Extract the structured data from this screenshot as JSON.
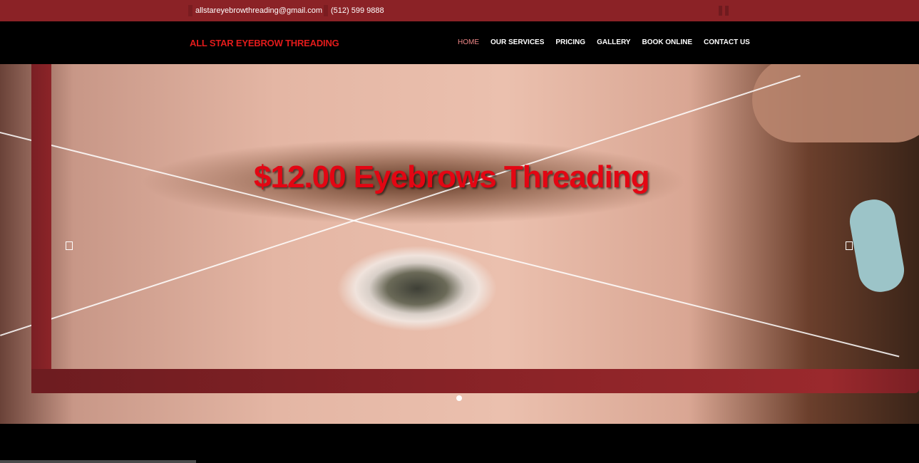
{
  "topbar": {
    "email": "allstareyebrowthreading@gmail.com",
    "phone": "(512) 599 9888"
  },
  "header": {
    "logo": "ALL STAR EYEBROW THREADING",
    "nav": [
      {
        "label": "HOME",
        "active": true
      },
      {
        "label": "OUR SERVICES",
        "active": false
      },
      {
        "label": "PRICING",
        "active": false
      },
      {
        "label": "GALLERY",
        "active": false
      },
      {
        "label": "BOOK ONLINE",
        "active": false
      },
      {
        "label": "CONTACT US",
        "active": false
      }
    ]
  },
  "hero": {
    "headline": "$12.00 Eyebrows Threading",
    "slide_count": 1,
    "active_slide": 1
  },
  "colors": {
    "brand_red": "#e21b1b",
    "topbar": "#8b2226",
    "frame": "#8c2428",
    "nav_active": "#f08888"
  }
}
